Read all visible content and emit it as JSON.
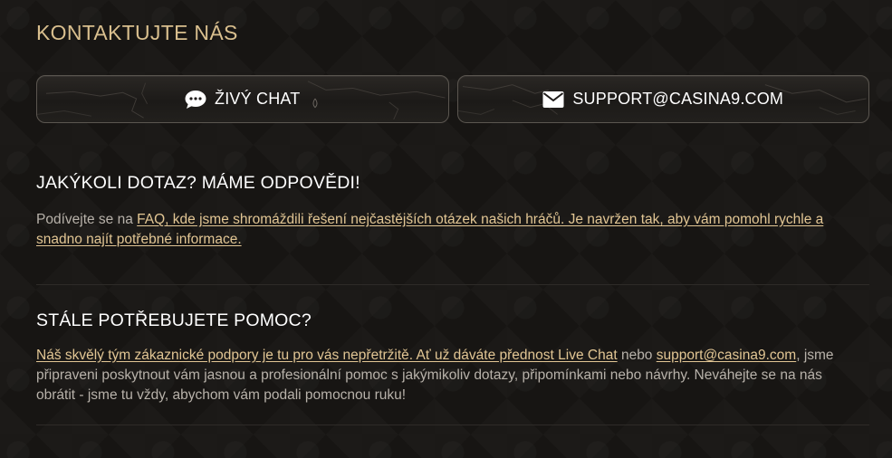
{
  "page": {
    "title": "KONTAKTUJTE NÁS"
  },
  "contact_buttons": {
    "chat": {
      "label": "ŽIVÝ CHAT",
      "icon": "chat-bubble-icon"
    },
    "email": {
      "label": "SUPPORT@CASINA9.COM",
      "icon": "envelope-icon"
    }
  },
  "faq_section": {
    "heading": "JAKÝKOLI DOTAZ? MÁME ODPOVĚDI!",
    "text_before": "Podívejte se na ",
    "link_text": "FAQ, kde jsme shromáždili řešení nejčastějších otázek našich hráčů. Je navržen tak, aby vám pomohl rychle a snadno najít potřebné informace."
  },
  "help_section": {
    "heading": "STÁLE POTŘEBUJETE POMOC?",
    "link_live_chat": "Náš skvělý tým zákaznické podpory je tu pro vás nepřetržitě. Ať už dáváte přednost Live Chat",
    "text_middle": " nebo ",
    "link_email": "support@casina9.com",
    "text_after": ", jsme připraveni poskytnout vám jasnou a profesionální pomoc s jakýmikoliv dotazy, připomínkami nebo návrhy. Neváhejte se na nás obrátit - jsme tu vždy, abychom vám podali pomocnou ruku!"
  },
  "colors": {
    "accent_gold": "#d9bf8e",
    "link": "#e2c694",
    "body_text": "#b8b2aa",
    "background": "#171513"
  }
}
